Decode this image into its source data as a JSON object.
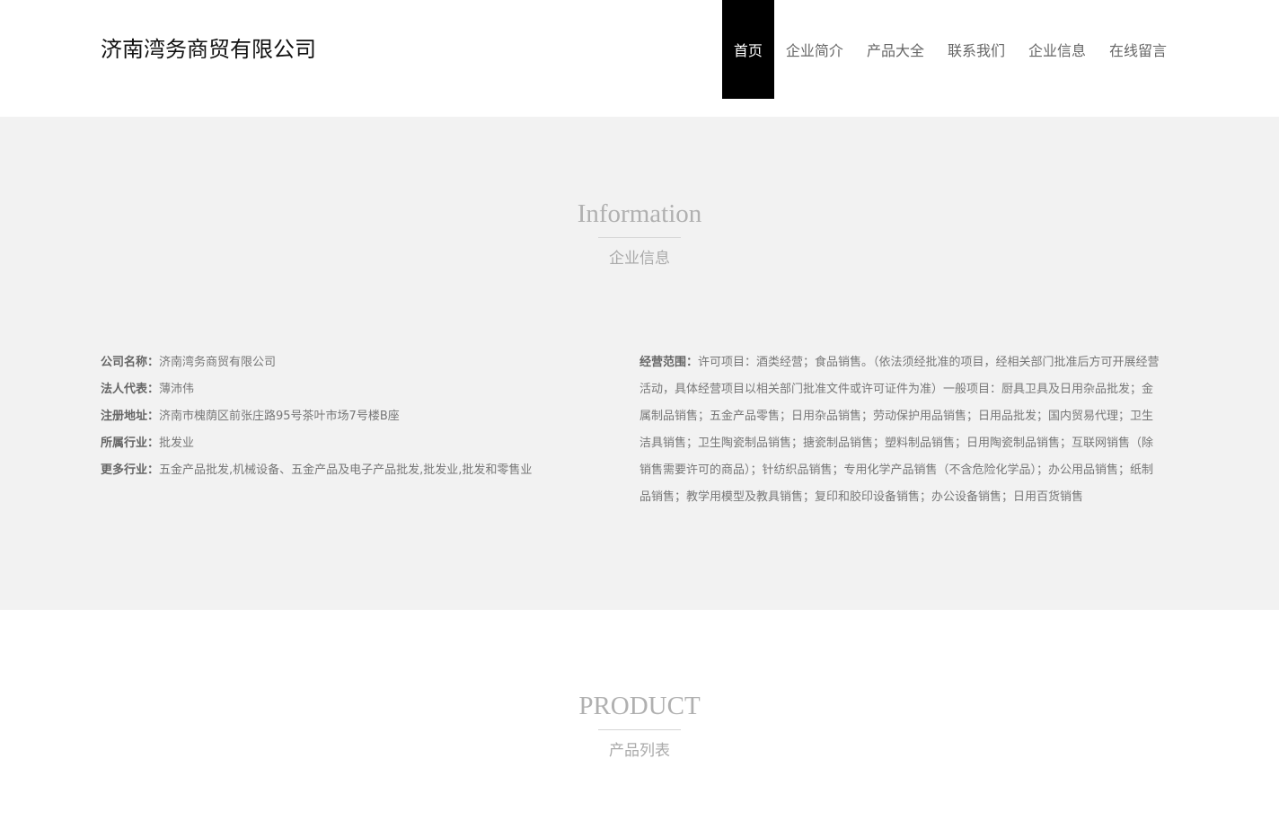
{
  "header": {
    "logo": "济南湾务商贸有限公司",
    "nav": [
      "首页",
      "企业简介",
      "产品大全",
      "联系我们",
      "企业信息",
      "在线留言"
    ]
  },
  "info": {
    "title_en": "Information",
    "title_cn": "企业信息",
    "left": [
      {
        "key": "公司名称：",
        "value": "济南湾务商贸有限公司"
      },
      {
        "key": "法人代表：",
        "value": "薄沛伟"
      },
      {
        "key": "注册地址：",
        "value": "济南市槐荫区前张庄路95号茶叶市场7号楼B座"
      },
      {
        "key": "所属行业：",
        "value": "批发业"
      },
      {
        "key": "更多行业：",
        "value": "五金产品批发,机械设备、五金产品及电子产品批发,批发业,批发和零售业"
      }
    ],
    "scope_key": "经营范围：",
    "scope_value": "许可项目：酒类经营；食品销售。（依法须经批准的项目，经相关部门批准后方可开展经营活动，具体经营项目以相关部门批准文件或许可证件为准）一般项目：厨具卫具及日用杂品批发；金属制品销售；五金产品零售；日用杂品销售；劳动保护用品销售；日用品批发；国内贸易代理；卫生洁具销售；卫生陶瓷制品销售；搪瓷制品销售；塑料制品销售；日用陶瓷制品销售；互联网销售（除销售需要许可的商品）；针纺织品销售；专用化学产品销售（不含危险化学品）；办公用品销售；纸制品销售；教学用模型及教具销售；复印和胶印设备销售；办公设备销售；日用百货销售"
  },
  "product": {
    "title_en": "PRODUCT",
    "title_cn": "产品列表"
  }
}
